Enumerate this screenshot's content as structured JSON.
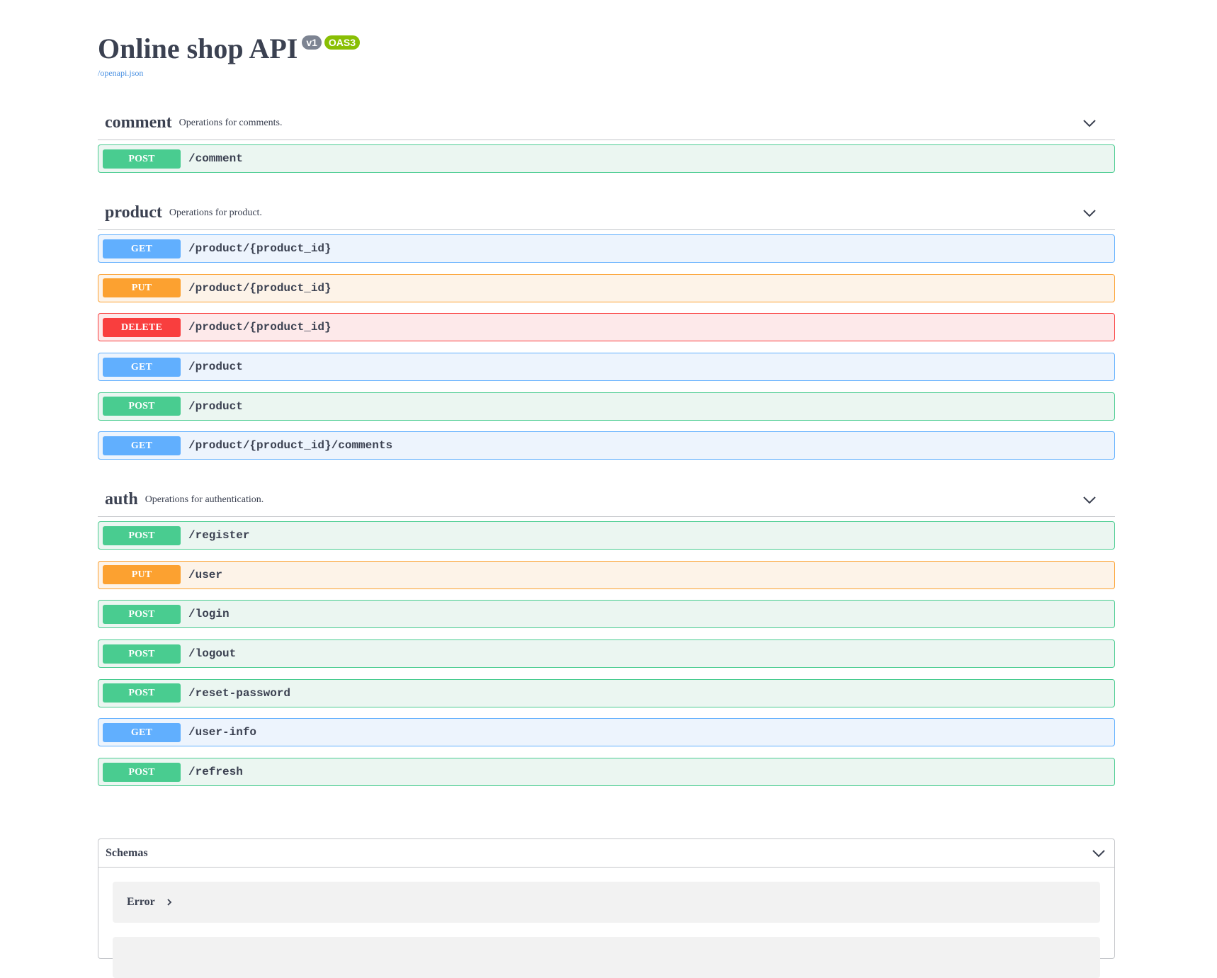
{
  "info": {
    "title": "Online shop API",
    "version": "v1",
    "oas_badge": "OAS3",
    "spec_link": "/openapi.json"
  },
  "tags": [
    {
      "name": "comment",
      "description": "Operations for comments.",
      "operations": [
        {
          "method": "POST",
          "path": "/comment"
        }
      ]
    },
    {
      "name": "product",
      "description": "Operations for product.",
      "operations": [
        {
          "method": "GET",
          "path": "/product/{product_id}"
        },
        {
          "method": "PUT",
          "path": "/product/{product_id}"
        },
        {
          "method": "DELETE",
          "path": "/product/{product_id}"
        },
        {
          "method": "GET",
          "path": "/product"
        },
        {
          "method": "POST",
          "path": "/product"
        },
        {
          "method": "GET",
          "path": "/product/{product_id}/comments"
        }
      ]
    },
    {
      "name": "auth",
      "description": "Operations for authentication.",
      "operations": [
        {
          "method": "POST",
          "path": "/register"
        },
        {
          "method": "PUT",
          "path": "/user"
        },
        {
          "method": "POST",
          "path": "/login"
        },
        {
          "method": "POST",
          "path": "/logout"
        },
        {
          "method": "POST",
          "path": "/reset-password"
        },
        {
          "method": "GET",
          "path": "/user-info"
        },
        {
          "method": "POST",
          "path": "/refresh"
        }
      ]
    }
  ],
  "schemas": {
    "title": "Schemas",
    "models": [
      {
        "name": "Error"
      },
      {
        "name": ""
      }
    ]
  },
  "icons": {
    "tag_toggle": "chevron-down-icon",
    "schemas_toggle": "chevron-down-icon",
    "model_expand": "chevron-right-icon"
  },
  "colors": {
    "text": "#3b4151",
    "post": "#49cc90",
    "get": "#61affe",
    "put": "#fca130",
    "delete": "#f93e3e",
    "version_badge": "#7d8492",
    "oas_badge": "#89bf04",
    "link": "#4990e2"
  }
}
